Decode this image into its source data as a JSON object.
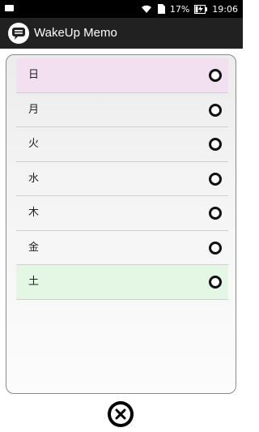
{
  "status_bar": {
    "battery": "17%",
    "time": "19:06"
  },
  "app": {
    "title": "WakeUp Memo",
    "icon": "chat-bubble-icon"
  },
  "days": [
    {
      "label": "日",
      "highlight": "#f2dff0"
    },
    {
      "label": "月"
    },
    {
      "label": "火"
    },
    {
      "label": "水"
    },
    {
      "label": "木"
    },
    {
      "label": "金"
    },
    {
      "label": "土",
      "highlight": "#e4f7e4"
    }
  ],
  "close_icon": "close-circle-icon"
}
